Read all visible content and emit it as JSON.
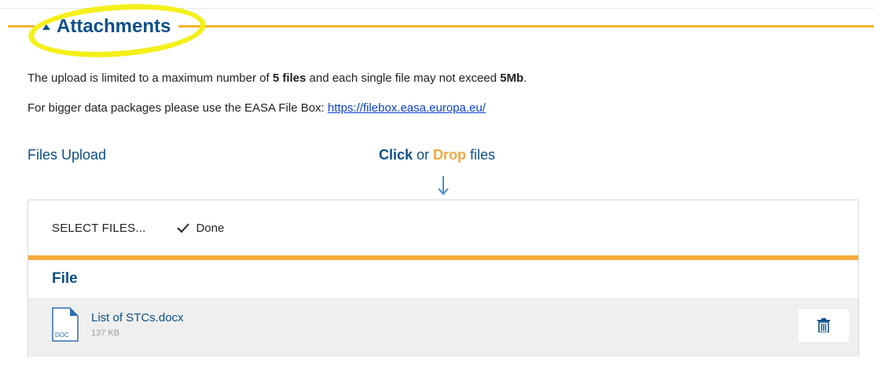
{
  "section": {
    "title": "Attachments",
    "info_line1_prefix": "The upload is limited to a maximum number of ",
    "info_line1_files": "5 files",
    "info_line1_middle": " and each single file may not exceed ",
    "info_line1_size": "5Mb",
    "info_line1_suffix": ".",
    "info_line2_prefix": "For bigger data packages please use the EASA File Box: ",
    "info_line2_link": "https://filebox.easa.europa.eu/"
  },
  "upload": {
    "label": "Files Upload",
    "hint_click": "Click",
    "hint_or": " or ",
    "hint_drop": "Drop",
    "hint_files": " files",
    "select_label": "SELECT FILES...",
    "done_label": "Done"
  },
  "table": {
    "column_file": "File",
    "rows": [
      {
        "name": "List of STCs.docx",
        "size": "137 KB",
        "type_badge": "DOC"
      }
    ]
  },
  "icons": {
    "section_toggle": "caret-up-icon",
    "drop_arrow": "arrow-down-icon",
    "done": "checkmark-icon",
    "file_type": "doc-file-icon",
    "delete": "trash-icon"
  },
  "colors": {
    "brand_blue": "#0b4f8a",
    "accent_orange": "#f7a93b",
    "link_blue": "#0b3fd6",
    "highlight_yellow": "#f4f01a"
  }
}
